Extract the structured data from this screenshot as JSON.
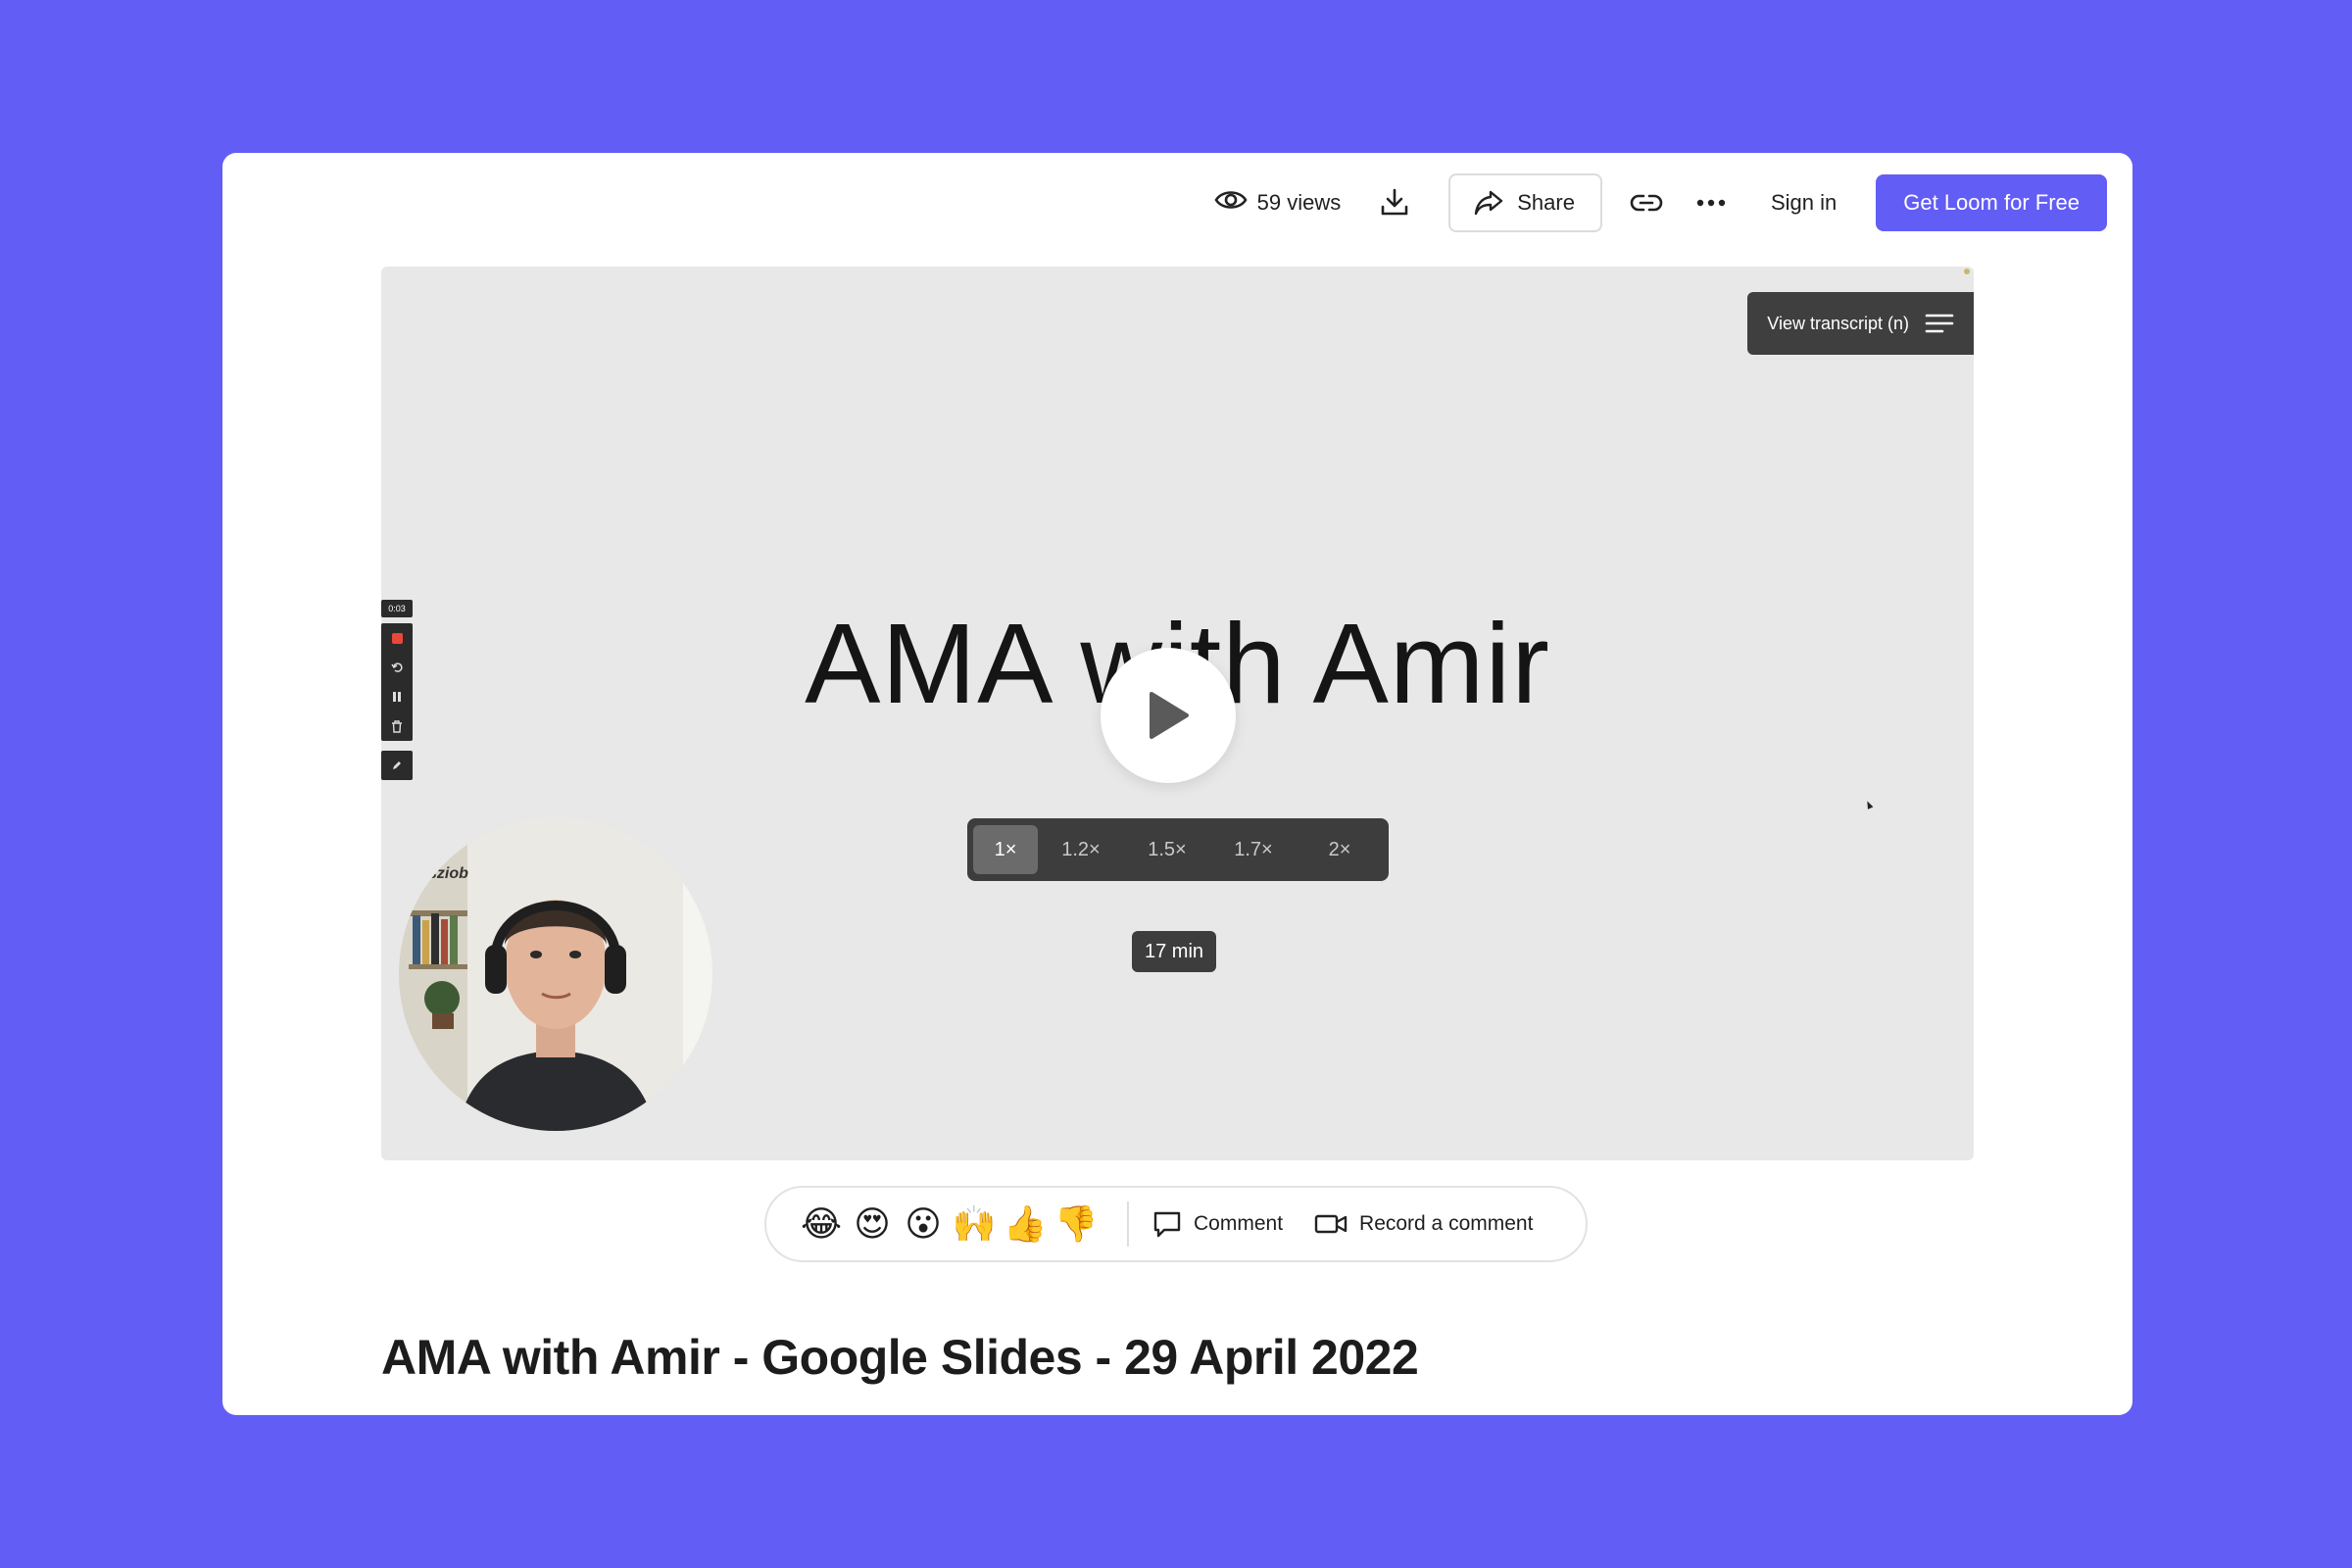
{
  "topbar": {
    "views_label": "59 views",
    "share_label": "Share",
    "signin_label": "Sign in",
    "cta_label": "Get Loom for Free"
  },
  "video": {
    "transcript_label": "View transcript (n)",
    "slide_text": "AMA with Amir",
    "speeds": [
      "1×",
      "1.2×",
      "1.5×",
      "1.7×",
      "2×"
    ],
    "active_speed": "1×",
    "duration": "17 min",
    "recorder_time": "0:03",
    "webcam_sign_text": "sziob"
  },
  "reactions": {
    "emojis": [
      "😂",
      "😍",
      "😮",
      "🙌",
      "👍",
      "👎"
    ],
    "comment_label": "Comment",
    "record_label": "Record a comment"
  },
  "title": "AMA with Amir - Google Slides - 29 April 2022",
  "colors": {
    "background": "#625DF5",
    "accent": "#625DF5",
    "video_bg": "#e8e8e8",
    "overlay_dark": "#3d3d3d"
  },
  "icons": [
    "eye-icon",
    "download-icon",
    "share-icon",
    "link-icon",
    "more-icon",
    "transcript-menu-icon",
    "play-icon",
    "comment-icon",
    "video-camera-icon"
  ]
}
